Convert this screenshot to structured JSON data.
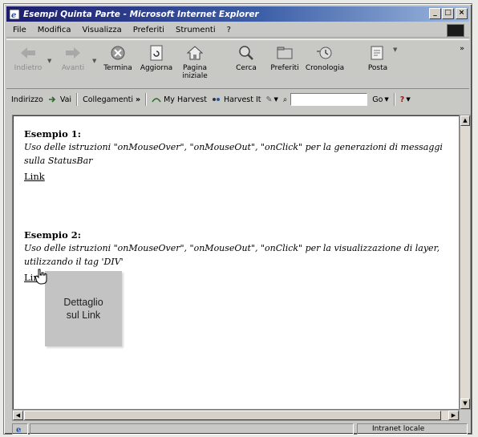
{
  "window": {
    "title": "Esempi Quinta Parte - Microsoft Internet Explorer",
    "controls": {
      "minimize": "_",
      "maximize": "□",
      "close": "×"
    }
  },
  "menubar": {
    "items": [
      "File",
      "Modifica",
      "Visualizza",
      "Preferiti",
      "Strumenti",
      "?"
    ]
  },
  "toolbar": {
    "buttons": [
      {
        "label": "Indietro",
        "icon": "back-arrow-icon",
        "enabled": false
      },
      {
        "label": "Avanti",
        "icon": "forward-arrow-icon",
        "enabled": false
      },
      {
        "label": "Termina",
        "icon": "stop-icon",
        "enabled": true
      },
      {
        "label": "Aggiorna",
        "icon": "refresh-icon",
        "enabled": true
      },
      {
        "label": "Pagina\niniziale",
        "icon": "home-icon",
        "enabled": true
      },
      {
        "label": "Cerca",
        "icon": "search-icon",
        "enabled": true
      },
      {
        "label": "Preferiti",
        "icon": "favorites-icon",
        "enabled": true
      },
      {
        "label": "Cronologia",
        "icon": "history-icon",
        "enabled": true
      },
      {
        "label": "Posta",
        "icon": "mail-icon",
        "enabled": true
      }
    ],
    "more": "»"
  },
  "addressbar": {
    "address_label": "Indirizzo",
    "go_label": "Vai",
    "links_label": "Collegamenti",
    "links_more": "»",
    "my_harvest": "My Harvest",
    "harvest_it": "Harvest It",
    "search_value": "",
    "go_button": "Go",
    "help": "?"
  },
  "content": {
    "example1": {
      "title": "Esempio 1:",
      "description": "Uso delle istruzioni \"onMouseOver\", \"onMouseOut\", \"onClick\" per la generazioni di messaggi sulla StatusBar",
      "link": "Link"
    },
    "example2": {
      "title": "Esempio 2:",
      "description": "Uso delle istruzioni \"onMouseOver\", \"onMouseOut\", \"onClick\" per la visualizzazione di layer, utilizzando il tag 'DIV'",
      "link": "Link"
    },
    "layer_text": "Dettaglio\nsul Link"
  },
  "statusbar": {
    "zone": "Intranet locale"
  }
}
